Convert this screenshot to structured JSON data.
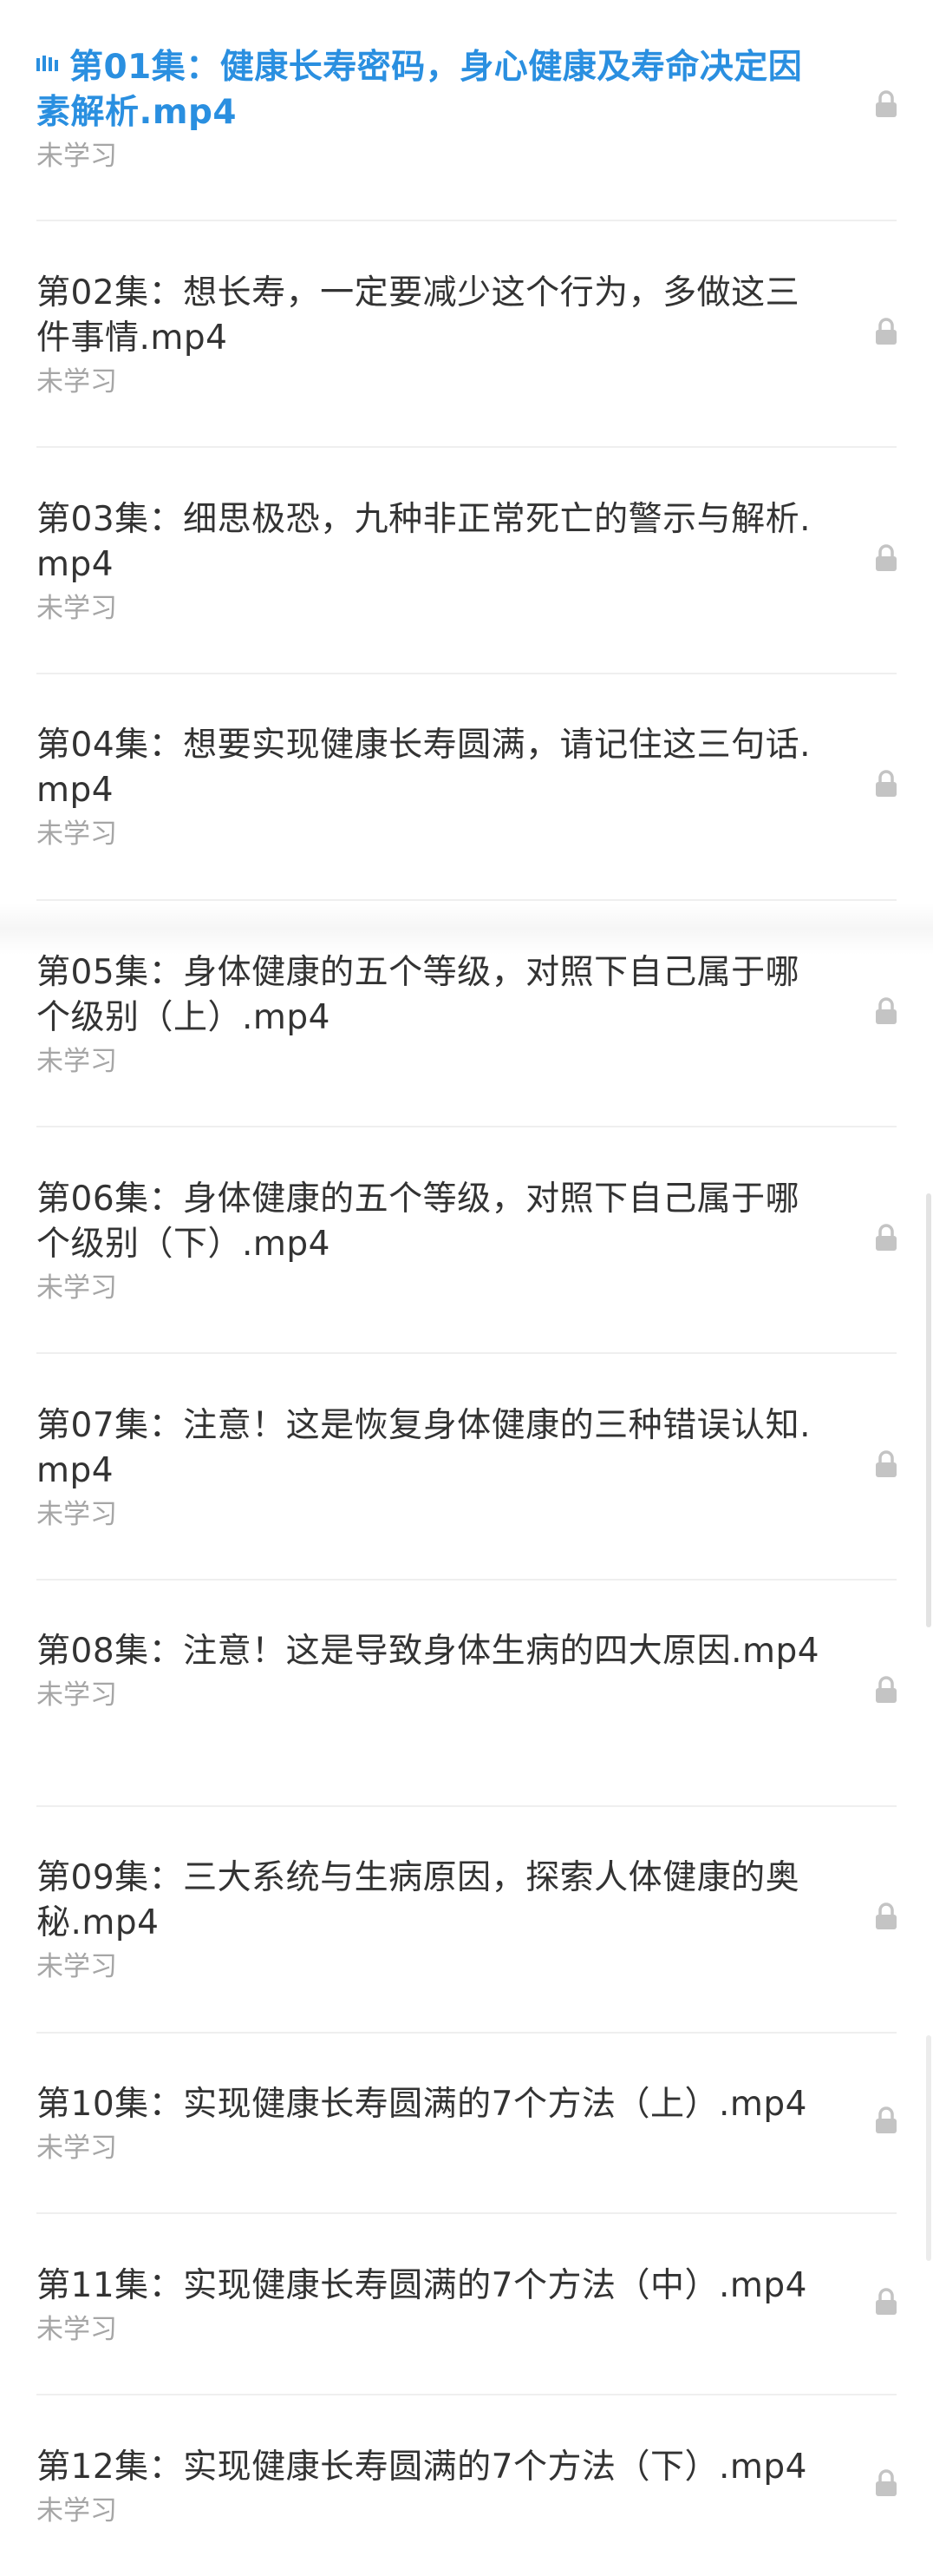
{
  "episodes": [
    {
      "title": "第01集：健康长寿密码，身心健康及寿命决定因素解析.mp4",
      "status": "未学习",
      "active": true
    },
    {
      "title": "第02集：想长寿，一定要减少这个行为，多做这三件事情.mp4",
      "status": "未学习"
    },
    {
      "title": "第03集：细思极恐，九种非正常死亡的警示与解析.mp4",
      "status": "未学习"
    },
    {
      "title": "第04集：想要实现健康长寿圆满，请记住这三句话.mp4",
      "status": "未学习"
    },
    {
      "title": "第05集：身体健康的五个等级，对照下自己属于哪个级别（上）.mp4",
      "status": "未学习"
    },
    {
      "title": "第06集：身体健康的五个等级，对照下自己属于哪个级别（下）.mp4",
      "status": "未学习"
    },
    {
      "title": "第07集：注意！这是恢复身体健康的三种错误认知.mp4",
      "status": "未学习"
    },
    {
      "title": "第08集：注意！这是导致身体生病的四大原因.mp4",
      "status": "未学习"
    },
    {
      "title": "第09集：三大系统与生病原因，探索人体健康的奥秘.mp4",
      "status": "未学习"
    },
    {
      "title": "第10集：实现健康长寿圆满的7个方法（上）.mp4",
      "status": "未学习"
    },
    {
      "title": "第11集：实现健康长寿圆满的7个方法（中）.mp4",
      "status": "未学习"
    },
    {
      "title": "第12集：实现健康长寿圆满的7个方法（下）.mp4",
      "status": "未学习"
    }
  ],
  "icons": {
    "playing": "playing-bars-icon",
    "lock": "lock-icon"
  },
  "colors": {
    "active_title": "#2a8fe0",
    "title": "#333333",
    "status": "#a6a6a6",
    "lock": "#c4c4c4",
    "divider": "#efefef"
  }
}
